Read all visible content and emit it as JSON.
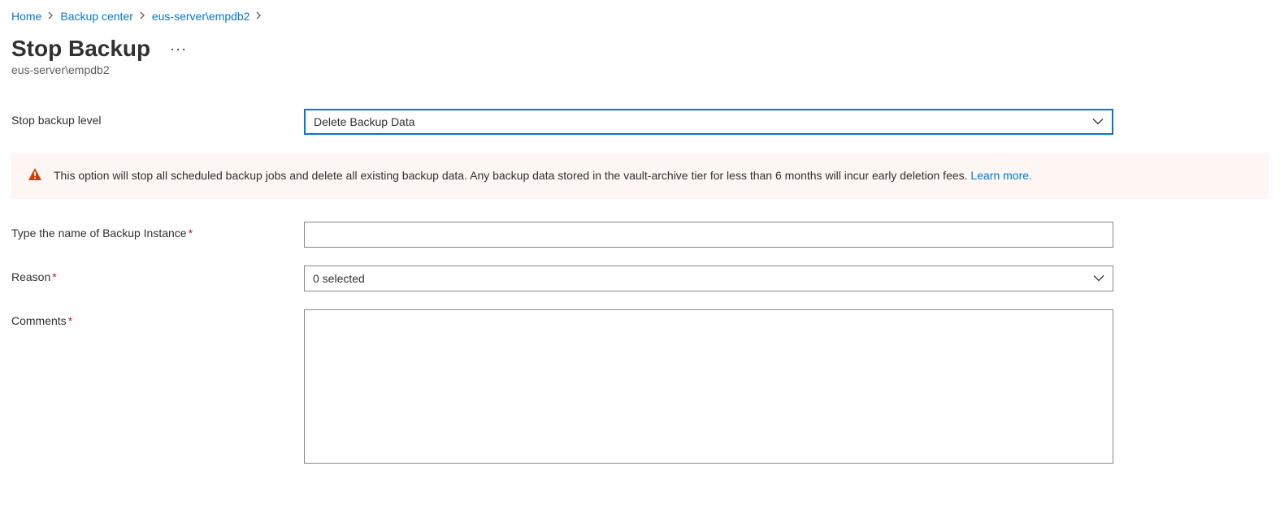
{
  "breadcrumb": {
    "items": [
      {
        "label": "Home"
      },
      {
        "label": "Backup center"
      },
      {
        "label": "eus-server\\empdb2"
      }
    ]
  },
  "header": {
    "title": "Stop Backup",
    "subtitle": "eus-server\\empdb2"
  },
  "form": {
    "stopLevel": {
      "label": "Stop backup level",
      "value": "Delete Backup Data"
    },
    "warning": {
      "text": "This option will stop all scheduled backup jobs and delete all existing backup data. Any backup data stored in the vault-archive tier for less than 6 months will incur early deletion fees. ",
      "linkText": "Learn more."
    },
    "instanceName": {
      "label": "Type the name of Backup Instance",
      "value": ""
    },
    "reason": {
      "label": "Reason",
      "value": "0 selected"
    },
    "comments": {
      "label": "Comments",
      "value": ""
    }
  }
}
